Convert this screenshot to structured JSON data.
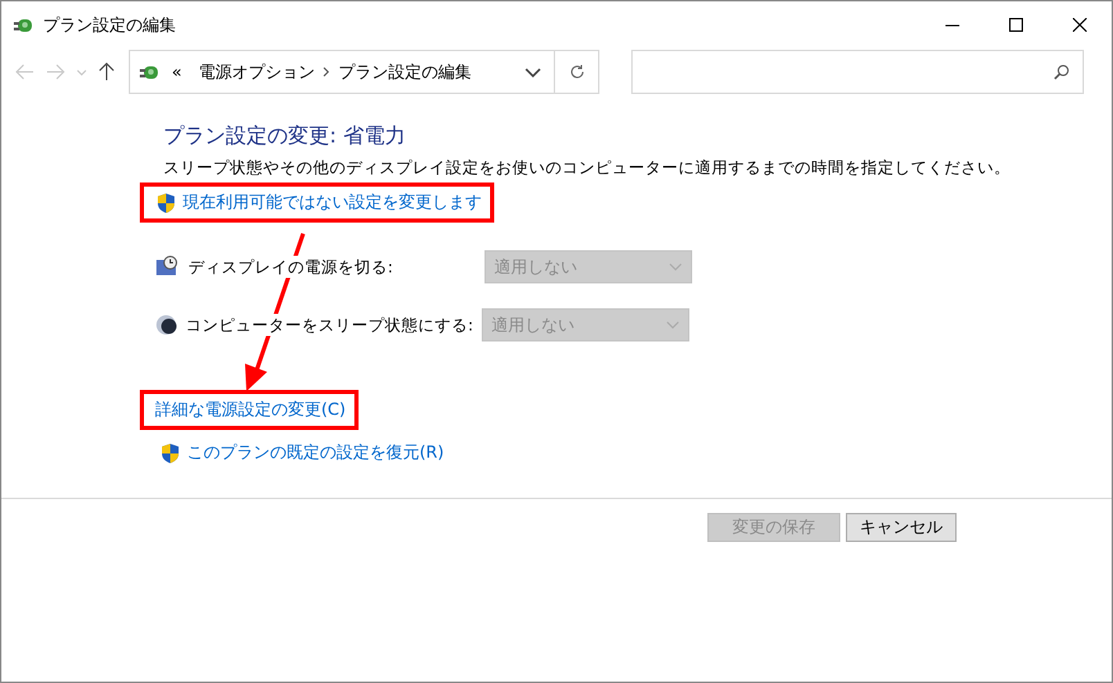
{
  "window": {
    "title": "プラン設定の編集"
  },
  "address_bar": {
    "overflow": "«",
    "crumbs": [
      "電源オプション",
      "プラン設定の編集"
    ]
  },
  "heading": "プラン設定の変更: 省電力",
  "description": "スリープ状態やその他のディスプレイ設定をお使いのコンピューターに適用するまでの時間を指定してください。",
  "top_link": {
    "label": "現在利用可能ではない設定を変更します",
    "shield": true,
    "highlighted": true
  },
  "settings": [
    {
      "kind": "display",
      "label": "ディスプレイの電源を切る:",
      "value": "適用しない",
      "disabled": true
    },
    {
      "kind": "sleep",
      "label": "コンピューターをスリープ状態にする:",
      "value": "適用しない",
      "disabled": true
    }
  ],
  "bottom_links": [
    {
      "label": "詳細な電源設定の変更(C)",
      "shield": false,
      "highlighted": true
    },
    {
      "label": "このプランの既定の設定を復元(R)",
      "shield": true,
      "highlighted": false
    }
  ],
  "annotation_arrow": true,
  "buttons": [
    {
      "label": "変更の保存",
      "disabled": true
    },
    {
      "label": "キャンセル",
      "disabled": false
    }
  ]
}
